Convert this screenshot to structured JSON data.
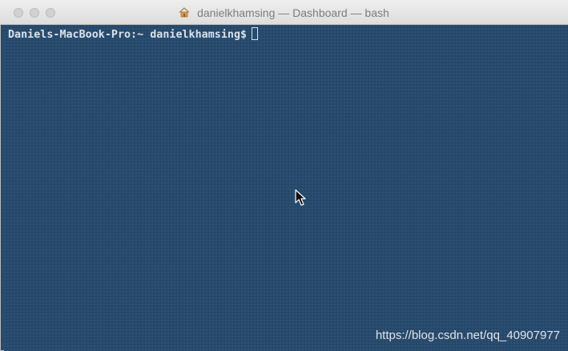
{
  "window": {
    "title": "danielkhamsing — Dashboard — bash"
  },
  "icons": {
    "title_icon": "home-icon",
    "pointer": "mouse-pointer-icon"
  },
  "terminal": {
    "prompt": "Daniels-MacBook-Pro:~ danielkhamsing$"
  },
  "watermark": {
    "text": "https://blog.csdn.net/qq_40907977"
  },
  "colors": {
    "terminal_bg": "#274b6e",
    "text": "#d9e2ea",
    "titlebar": "#e6e6e6"
  }
}
